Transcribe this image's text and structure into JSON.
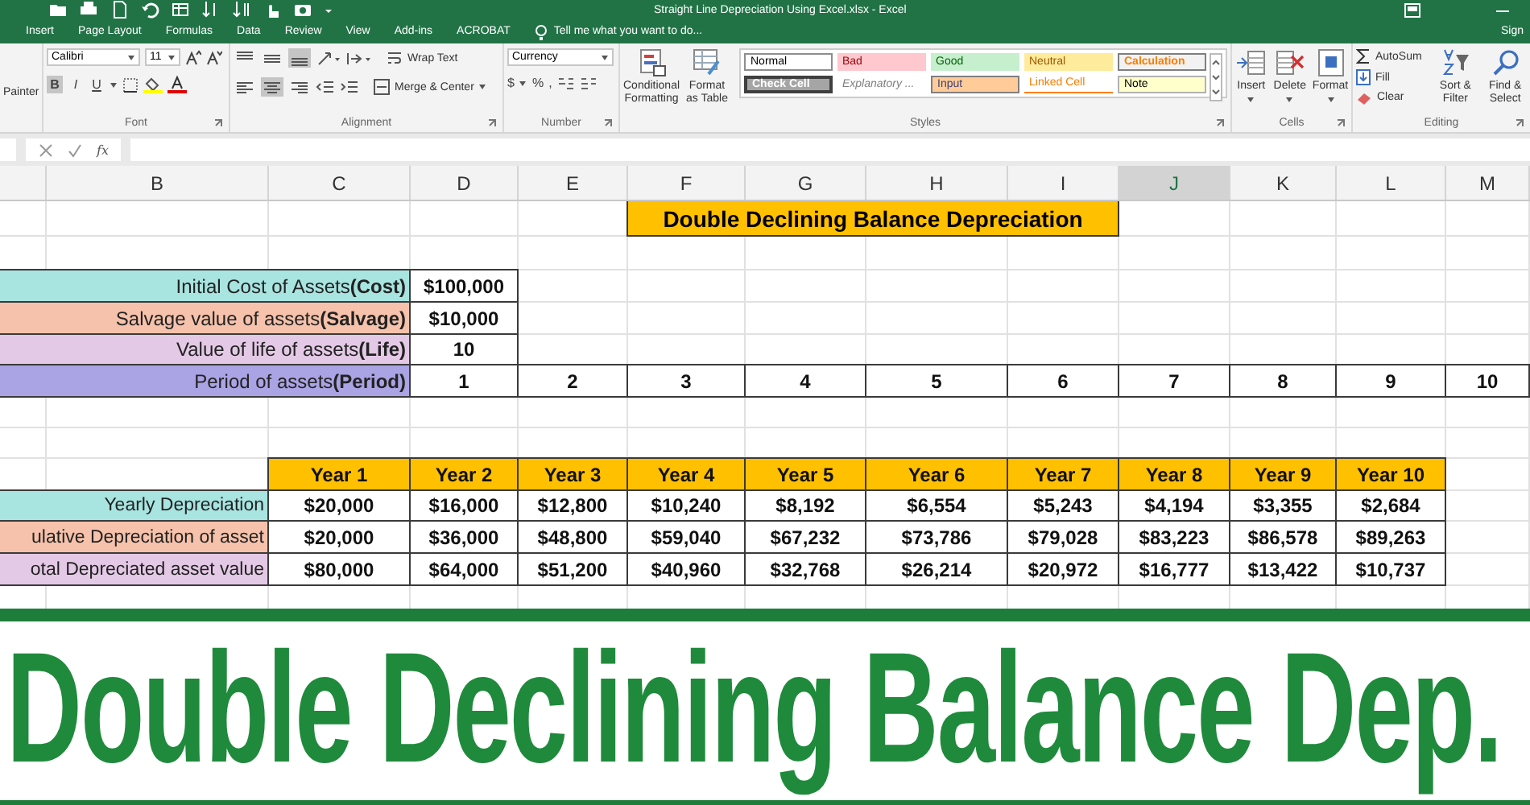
{
  "window": {
    "title": "Straight Line Depreciation Using Excel.xlsx - Excel",
    "account": "Sign"
  },
  "tabs": [
    {
      "label": "Insert",
      "selected": false
    },
    {
      "label": "Page Layout",
      "selected": false
    },
    {
      "label": "Formulas",
      "selected": false
    },
    {
      "label": "Data",
      "selected": false
    },
    {
      "label": "Review",
      "selected": false
    },
    {
      "label": "View",
      "selected": false
    },
    {
      "label": "Add-ins",
      "selected": false
    },
    {
      "label": "ACROBAT",
      "selected": false
    }
  ],
  "tell_me": "Tell me what you want to do...",
  "ribbon": {
    "clipboard": {
      "painter": "Painter"
    },
    "font": {
      "name": "Calibri",
      "size": "11",
      "bold": {
        "label": "B",
        "on": true
      },
      "italic": {
        "label": "I",
        "on": false
      },
      "underline": {
        "label": "U",
        "on": false
      },
      "label": "Font"
    },
    "alignment": {
      "top_row": [
        {
          "kind": "top",
          "on": false
        },
        {
          "kind": "middle",
          "on": false
        },
        {
          "kind": "bottom",
          "on": true
        }
      ],
      "bottom_row": [
        {
          "kind": "left",
          "on": false
        },
        {
          "kind": "center",
          "on": true
        },
        {
          "kind": "right",
          "on": false
        }
      ],
      "wrap": "Wrap Text",
      "merge": "Merge & Center",
      "label": "Alignment"
    },
    "number": {
      "format": "Currency",
      "currency": "$",
      "percent": "%",
      "comma": ",",
      "label": "Number"
    },
    "styles": {
      "conditional": "Conditional Formatting",
      "table": "Format as Table",
      "cells": [
        {
          "label": "Normal",
          "kind": "normal"
        },
        {
          "label": "Bad",
          "kind": "bad"
        },
        {
          "label": "Good",
          "kind": "good"
        },
        {
          "label": "Neutral",
          "kind": "neutral"
        },
        {
          "label": "Calculation",
          "kind": "calculation"
        },
        {
          "label": "Check Cell",
          "kind": "check"
        },
        {
          "label": "Explanatory ...",
          "kind": "explanatory"
        },
        {
          "label": "Input",
          "kind": "input"
        },
        {
          "label": "Linked Cell",
          "kind": "linked"
        },
        {
          "label": "Note",
          "kind": "note"
        }
      ],
      "label": "Styles"
    },
    "cells": {
      "insert": "Insert",
      "delete": "Delete",
      "format": "Format",
      "label": "Cells"
    },
    "editing": {
      "autosum": "AutoSum",
      "fill": "Fill",
      "clear": "Clear",
      "sort": "Sort & Filter",
      "find": "Find & Select",
      "label": "Editing"
    }
  },
  "formula_bar": {
    "function_label": "fx"
  },
  "columns": [
    {
      "label": "B",
      "selected": false
    },
    {
      "label": "C",
      "selected": false
    },
    {
      "label": "D",
      "selected": false
    },
    {
      "label": "E",
      "selected": false
    },
    {
      "label": "F",
      "selected": false
    },
    {
      "label": "G",
      "selected": false
    },
    {
      "label": "H",
      "selected": false
    },
    {
      "label": "I",
      "selected": false
    },
    {
      "label": "J",
      "selected": true
    },
    {
      "label": "K",
      "selected": false
    },
    {
      "label": "L",
      "selected": false
    },
    {
      "label": "M",
      "selected": false
    }
  ],
  "sheet": {
    "title": "Double Declining Balance Depreciation",
    "inputs": [
      {
        "label": "Initial Cost of Assets**(Cost)**",
        "value": "$100,000",
        "color": "#a8e4e0"
      },
      {
        "label": "Salvage value of assets**(Salvage)**",
        "value": "$10,000",
        "color": "#f6c2ab"
      },
      {
        "label": "Value of life of assets**(Life)**",
        "value": "10",
        "color": "#e4c9e6"
      }
    ],
    "period": {
      "label": "Period of assets**(Period)**",
      "color": "#aaa3e4",
      "values": [
        "1",
        "2",
        "3",
        "4",
        "5",
        "6",
        "7",
        "8",
        "9",
        "10"
      ]
    },
    "year_headers": [
      "Year 1",
      "Year 2",
      "Year 3",
      "Year 4",
      "Year 5",
      "Year 6",
      "Year 7",
      "Year 8",
      "Year 9",
      "Year 10"
    ],
    "rows": [
      {
        "label": "Yearly Depreciation",
        "color": "#a8e4e0",
        "values": [
          "$20,000",
          "$16,000",
          "$12,800",
          "$10,240",
          "$8,192",
          "$6,554",
          "$5,243",
          "$4,194",
          "$3,355",
          "$2,684"
        ]
      },
      {
        "label": "ulative Depreciation of asset",
        "color": "#f6c2ab",
        "values": [
          "$20,000",
          "$36,000",
          "$48,800",
          "$59,040",
          "$67,232",
          "$73,786",
          "$79,028",
          "$83,223",
          "$86,578",
          "$89,263"
        ]
      },
      {
        "label": "otal Depreciated asset value",
        "color": "#e4c9e6",
        "values": [
          "$80,000",
          "$64,000",
          "$51,200",
          "$40,960",
          "$32,768",
          "$26,214",
          "$20,972",
          "$16,777",
          "$13,422",
          "$10,737"
        ]
      }
    ]
  },
  "banner": {
    "text": "Double Declining Balance Dep."
  }
}
